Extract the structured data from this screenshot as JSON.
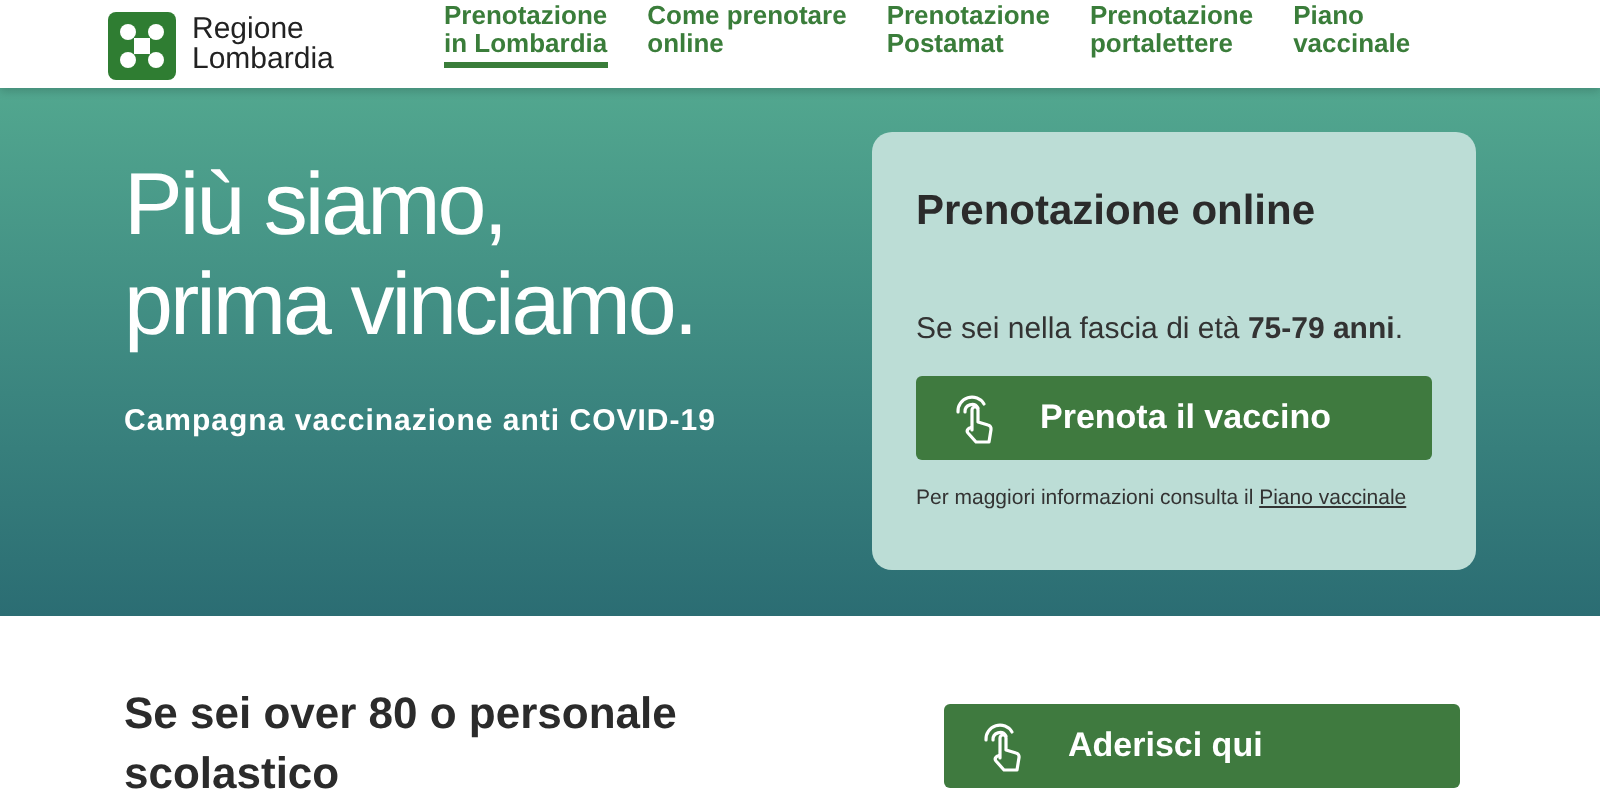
{
  "logo": {
    "line1": "Regione",
    "line2": "Lombardia"
  },
  "nav": [
    {
      "label_lines": [
        "Prenotazione",
        "in Lombardia"
      ],
      "selected": true
    },
    {
      "label_lines": [
        "Come prenotare",
        "online"
      ],
      "selected": false
    },
    {
      "label_lines": [
        "Prenotazione",
        "Postamat"
      ],
      "selected": false
    },
    {
      "label_lines": [
        "Prenotazione",
        "portalettere"
      ],
      "selected": false
    },
    {
      "label_lines": [
        "Piano",
        "vaccinale"
      ],
      "selected": false
    }
  ],
  "hero": {
    "headline_lines": [
      "Più siamo,",
      "prima vinciamo."
    ],
    "subtitle": "Campagna vaccinazione anti COVID-19"
  },
  "card": {
    "title": "Prenotazione online",
    "text": "Se sei nella fascia di età **75-79 anni**.",
    "button": "Prenota il vaccino",
    "note": "Per maggiori informazioni consulta il",
    "link": "Piano vaccinale"
  },
  "section": {
    "title": "Se sei over 80 o personale scolastico",
    "button": "Aderisci qui"
  }
}
